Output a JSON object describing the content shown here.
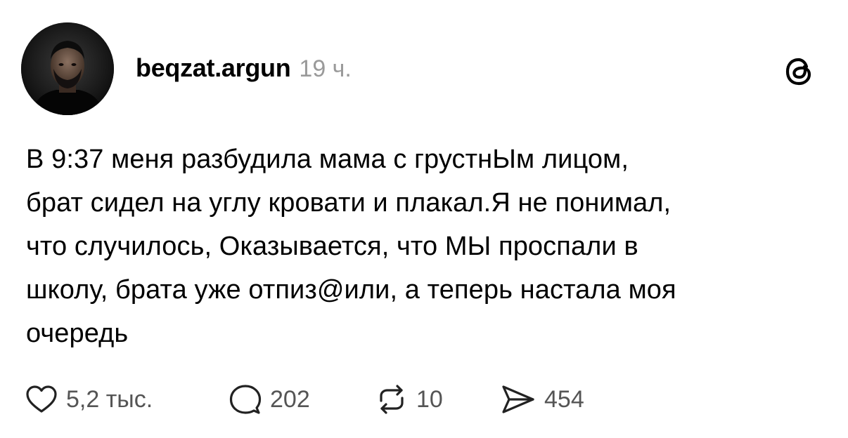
{
  "post": {
    "author": {
      "username": "beqzat.argun",
      "time_ago": "19 ч."
    },
    "text_lines": [
      "В 9:37 меня разбудила мама с грустнЫм лицом,",
      "брат сидел на углу кровати и плакал.Я не понимал,",
      "что случилось, Оказывается, что МЫ проспали в",
      "школу, брата уже отпиз@или, а теперь настала моя",
      "очередь"
    ],
    "actions": {
      "likes": "5,2 тыс.",
      "replies": "202",
      "reposts": "10",
      "shares": "454"
    },
    "icons": {
      "logo": "threads-logo-icon",
      "like": "heart-icon",
      "reply": "speech-bubble-icon",
      "repost": "repost-icon",
      "share": "send-icon"
    },
    "colors": {
      "text": "#000000",
      "muted": "#9a9a9a",
      "count": "#555555",
      "background": "#ffffff"
    }
  }
}
